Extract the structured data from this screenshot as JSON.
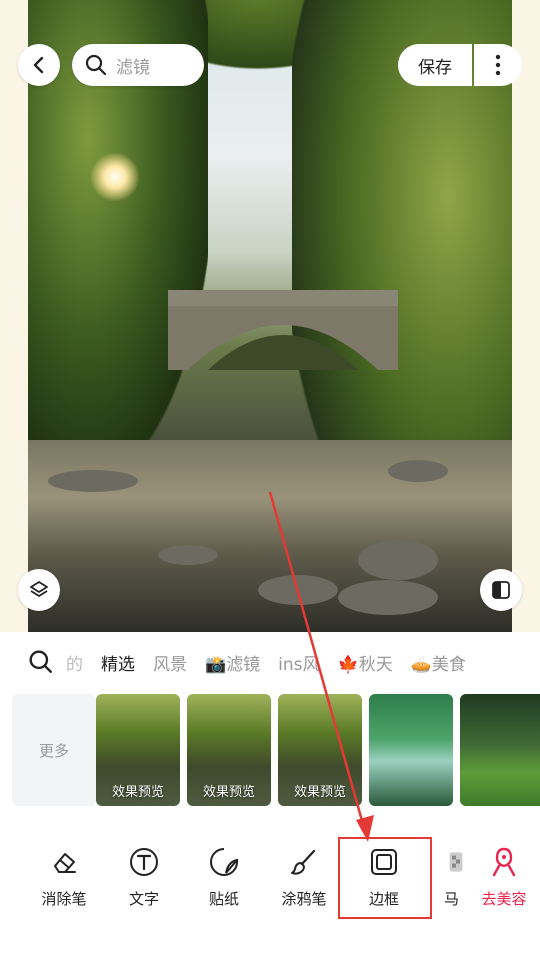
{
  "top_bar": {
    "search_placeholder": "滤镜",
    "save_label": "保存"
  },
  "filter_tabs": [
    {
      "label": "的"
    },
    {
      "label": "精选",
      "active": true
    },
    {
      "label": "风景"
    },
    {
      "label": "📸滤镜"
    },
    {
      "label": "ins风"
    },
    {
      "label": "🍁秋天"
    },
    {
      "label": "🥧美食"
    }
  ],
  "thumbnails": [
    {
      "label": "更多"
    },
    {
      "label": "效果预览"
    },
    {
      "label": "效果预览"
    },
    {
      "label": "效果预览"
    },
    {
      "label": ""
    },
    {
      "label": ""
    }
  ],
  "tools": [
    {
      "label": "消除笔",
      "icon": "eraser-icon"
    },
    {
      "label": "文字",
      "icon": "text-icon"
    },
    {
      "label": "贴纸",
      "icon": "sticker-icon"
    },
    {
      "label": "涂鸦笔",
      "icon": "brush-icon"
    },
    {
      "label": "边框",
      "icon": "frame-icon"
    },
    {
      "label": "马",
      "icon": "mosaic-icon"
    },
    {
      "label": "去美容",
      "icon": "beauty-icon"
    }
  ],
  "colors": {
    "accent_red": "#e53935",
    "beauty_pink": "#e8254f",
    "inactive_text": "#999999"
  }
}
